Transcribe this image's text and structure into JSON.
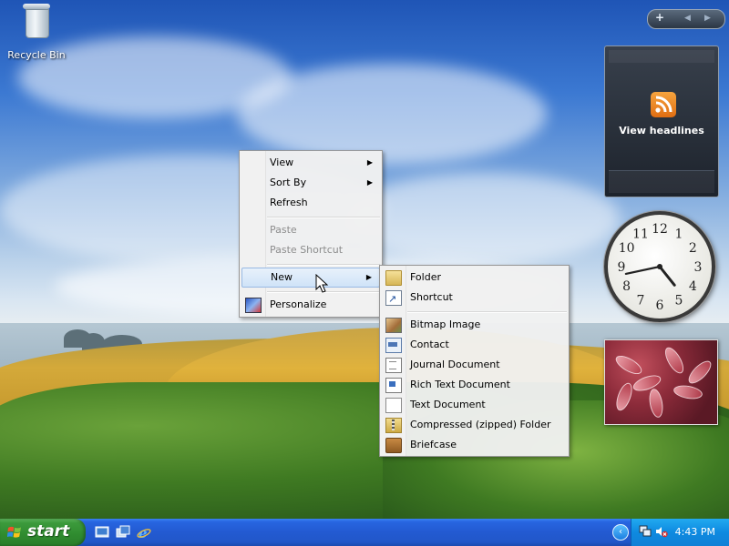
{
  "desktop": {
    "icons": [
      {
        "label": "Recycle Bin",
        "icon": "recycle-bin-icon"
      }
    ]
  },
  "context_menu": {
    "items": [
      {
        "label": "View",
        "submenu": true,
        "enabled": true
      },
      {
        "label": "Sort By",
        "submenu": true,
        "enabled": true
      },
      {
        "label": "Refresh",
        "submenu": false,
        "enabled": true
      },
      {
        "label": "Paste",
        "submenu": false,
        "enabled": false
      },
      {
        "label": "Paste Shortcut",
        "submenu": false,
        "enabled": false
      },
      {
        "label": "New",
        "submenu": true,
        "enabled": true,
        "highlighted": true
      },
      {
        "label": "Personalize",
        "submenu": false,
        "enabled": true,
        "icon": "personalize-icon"
      }
    ]
  },
  "new_submenu": {
    "items": [
      {
        "label": "Folder",
        "icon": "folder-icon"
      },
      {
        "label": "Shortcut",
        "icon": "shortcut-icon"
      },
      {
        "label": "Bitmap Image",
        "icon": "bitmap-icon"
      },
      {
        "label": "Contact",
        "icon": "contact-icon"
      },
      {
        "label": "Journal Document",
        "icon": "journal-icon"
      },
      {
        "label": "Rich Text Document",
        "icon": "rich-text-icon"
      },
      {
        "label": "Text Document",
        "icon": "text-document-icon"
      },
      {
        "label": "Compressed (zipped) Folder",
        "icon": "zip-folder-icon"
      },
      {
        "label": "Briefcase",
        "icon": "briefcase-icon"
      }
    ]
  },
  "sidebar": {
    "toolbar": {
      "add": "+",
      "prev": "◀",
      "next": "▶"
    },
    "headlines_gadget": {
      "label": "View headlines",
      "icon": "rss-icon",
      "accent": "#f08a24"
    },
    "clock_gadget": {
      "hour": 4,
      "minute": 43,
      "numerals": [
        "12",
        "1",
        "2",
        "3",
        "4",
        "5",
        "6",
        "7",
        "8",
        "9",
        "10",
        "11"
      ]
    },
    "slideshow_gadget": {
      "icon": "photo-slideshow-icon"
    }
  },
  "taskbar": {
    "start_label": "start",
    "quick_launch": [
      "show-desktop-icon",
      "switch-windows-icon",
      "internet-explorer-icon"
    ],
    "tray_icons": [
      "network-icon",
      "volume-muted-icon"
    ],
    "clock": "4:43 PM",
    "colors": {
      "taskbar": "#2157c9",
      "start": "#3c9a3c",
      "tray": "#0e8ae0"
    }
  }
}
